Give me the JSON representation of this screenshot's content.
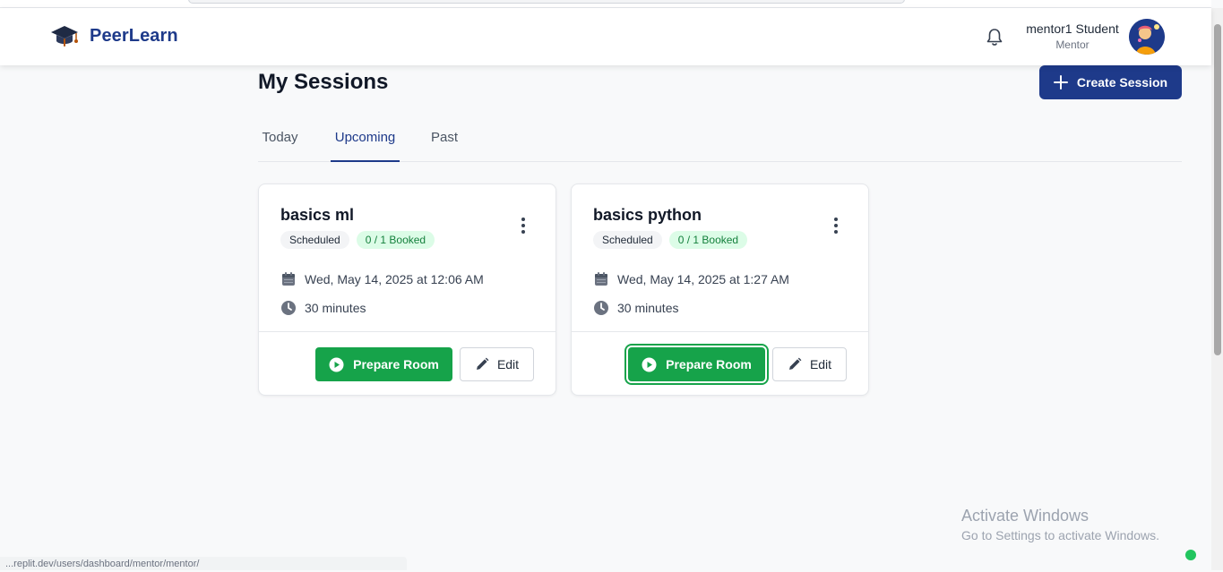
{
  "app": {
    "name": "PeerLearn"
  },
  "header": {
    "user_name": "mentor1 Student",
    "user_role": "Mentor"
  },
  "page": {
    "title": "My Sessions",
    "create_label": "Create Session"
  },
  "tabs": [
    {
      "label": "Today",
      "active": false
    },
    {
      "label": "Upcoming",
      "active": true
    },
    {
      "label": "Past",
      "active": false
    }
  ],
  "sessions": [
    {
      "title": "basics ml",
      "status": "Scheduled",
      "booking": "0 / 1 Booked",
      "datetime": "Wed, May 14, 2025 at 12:06 AM",
      "duration": "30 minutes",
      "primary_label": "Prepare Room",
      "edit_label": "Edit"
    },
    {
      "title": "basics python",
      "status": "Scheduled",
      "booking": "0 / 1 Booked",
      "datetime": "Wed, May 14, 2025 at 1:27 AM",
      "duration": "30 minutes",
      "primary_label": "Prepare Room",
      "edit_label": "Edit"
    }
  ],
  "overlay": {
    "watermark_line1": "Activate Windows",
    "watermark_line2": "Go to Settings to activate Windows.",
    "status_url": "...replit.dev/users/dashboard/mentor/mentor/"
  },
  "icons": {
    "logo": "graduation-cap-icon",
    "notifications": "bell-icon",
    "create": "plus-icon",
    "menu": "kebab-icon",
    "date": "calendar-icon",
    "duration": "clock-icon",
    "prepare": "play-circle-icon",
    "edit": "pencil-icon"
  },
  "colors": {
    "brand": "#1e3a8a",
    "success": "#16a34a",
    "badge_green_bg": "#dcfce7",
    "badge_green_text": "#15803d"
  }
}
